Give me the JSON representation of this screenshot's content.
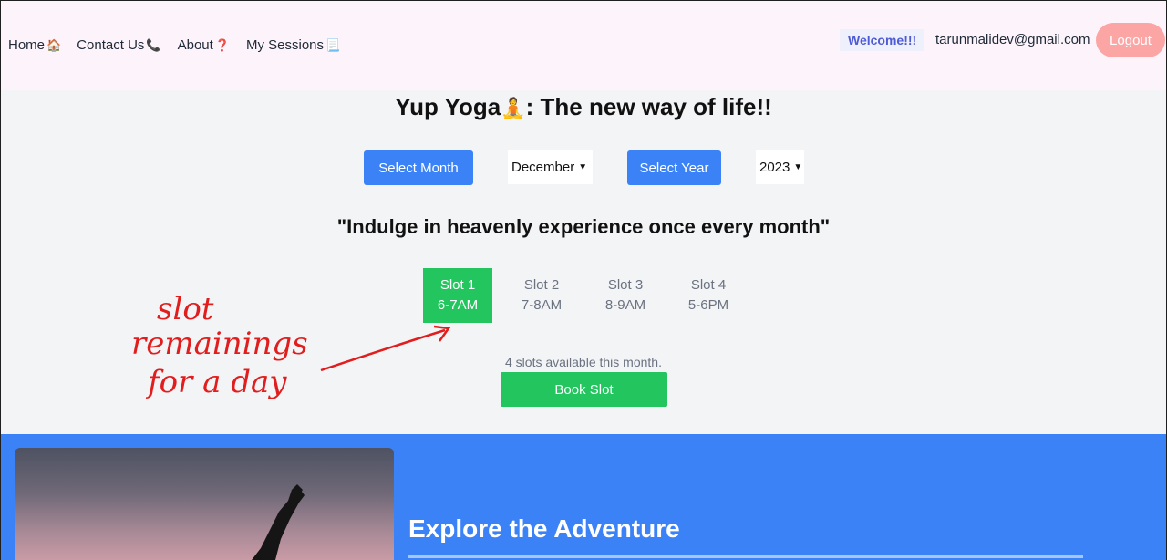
{
  "nav": {
    "home": "Home",
    "contact": "Contact Us",
    "about": "About",
    "sessions": "My Sessions",
    "welcome": "Welcome!!!",
    "email": "tarunmalidev@gmail.com",
    "logout": "Logout"
  },
  "icons": {
    "home": "house-emoji",
    "contact": "telephone-receiver-emoji",
    "about": "red-question-mark-emoji",
    "sessions": "page-with-curl-emoji",
    "title": "person-in-lotus-position-emoji"
  },
  "main": {
    "title_before": "Yup Yoga",
    "title_after": ": The new way of life!!",
    "select_month_label": "Select Month",
    "month_value": "December",
    "select_year_label": "Select Year",
    "year_value": "2023",
    "quote": "\"Indulge in heavenly experience once every month\"",
    "slots": [
      {
        "name": "Slot 1",
        "time": "6-7AM",
        "selected": true
      },
      {
        "name": "Slot 2",
        "time": "7-8AM",
        "selected": false
      },
      {
        "name": "Slot 3",
        "time": "8-9AM",
        "selected": false
      },
      {
        "name": "Slot 4",
        "time": "5-6PM",
        "selected": false
      }
    ],
    "availability": "4 slots available this month.",
    "book_label": "Book Slot"
  },
  "annotation": {
    "lines": [
      "slot",
      "remainings",
      "for a day"
    ],
    "color": "#e11d1d"
  },
  "hero": {
    "title": "Explore the Adventure"
  },
  "colors": {
    "primary_blue": "#3b82f6",
    "success_green": "#22c55e",
    "logout_pink": "#fca5a5",
    "navbar_bg": "#fdf4fb"
  }
}
